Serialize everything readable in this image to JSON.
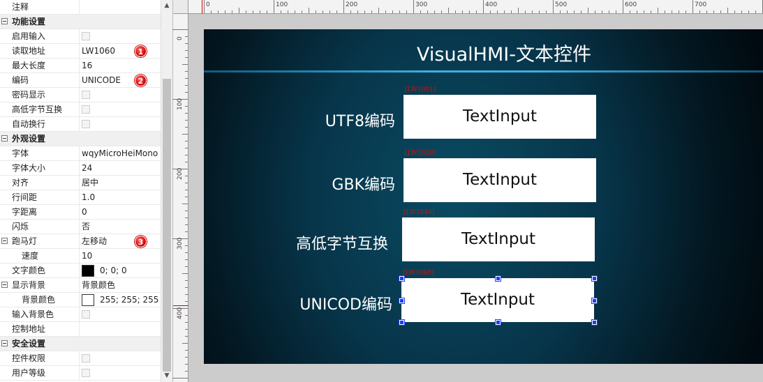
{
  "property_panel": {
    "rows": [
      {
        "kind": "prop",
        "name": "注释",
        "value": ""
      },
      {
        "kind": "section",
        "name": "功能设置"
      },
      {
        "kind": "prop",
        "name": "启用输入",
        "checkbox": true
      },
      {
        "kind": "prop",
        "name": "读取地址",
        "value": "LW1060",
        "badge": "1"
      },
      {
        "kind": "prop",
        "name": "最大长度",
        "value": "16"
      },
      {
        "kind": "prop",
        "name": "编码",
        "value": "UNICODE",
        "badge": "2"
      },
      {
        "kind": "prop",
        "name": "密码显示",
        "checkbox": true
      },
      {
        "kind": "prop",
        "name": "高低字节互换",
        "checkbox": true
      },
      {
        "kind": "prop",
        "name": "自动换行",
        "checkbox": true
      },
      {
        "kind": "section",
        "name": "外观设置"
      },
      {
        "kind": "prop",
        "name": "字体",
        "value": "wqyMicroHeiMono"
      },
      {
        "kind": "prop",
        "name": "字体大小",
        "value": "24"
      },
      {
        "kind": "prop",
        "name": "对齐",
        "value": "居中"
      },
      {
        "kind": "prop",
        "name": "行间距",
        "value": "1.0"
      },
      {
        "kind": "prop",
        "name": "字距离",
        "value": "0"
      },
      {
        "kind": "prop",
        "name": "闪烁",
        "value": "否"
      },
      {
        "kind": "prop",
        "name": "跑马灯",
        "value": "左移动",
        "badge": "3",
        "toggle": true
      },
      {
        "kind": "prop",
        "name": "速度",
        "value": "10",
        "indent": true
      },
      {
        "kind": "prop",
        "name": "文字颜色",
        "value": "0; 0; 0",
        "swatch": "#000000"
      },
      {
        "kind": "prop",
        "name": "显示背景",
        "value": "背景颜色",
        "toggle": true
      },
      {
        "kind": "prop",
        "name": "背景颜色",
        "value": "255; 255; 255",
        "swatch": "#ffffff",
        "indent": true
      },
      {
        "kind": "prop",
        "name": "输入背景色",
        "checkbox": true
      },
      {
        "kind": "prop",
        "name": "控制地址",
        "value": ""
      },
      {
        "kind": "section",
        "name": "安全设置"
      },
      {
        "kind": "prop",
        "name": "控件权限",
        "checkbox": true
      },
      {
        "kind": "prop",
        "name": "用户等级",
        "checkbox": true
      }
    ]
  },
  "scrollbar": {
    "up_icon": "▲",
    "down_icon": "▼"
  },
  "ruler": {
    "top_labels": [
      "0",
      "100",
      "200",
      "300",
      "400",
      "500",
      "600",
      "700"
    ],
    "left_labels": [
      "0",
      "100",
      "200",
      "300",
      "400"
    ]
  },
  "screen": {
    "title": "VisualHMI-文本控件",
    "rows": [
      {
        "label": "UTF8编码",
        "address": "[LW1001]",
        "text": "TextInput"
      },
      {
        "label": "GBK编码",
        "address": "[LW1020]",
        "text": "TextInput"
      },
      {
        "label": "高低字节互换",
        "address": "[LW1040]",
        "text": "TextInput"
      },
      {
        "label": "UNICOD编码",
        "address": "[LW1060]",
        "text": "TextInput",
        "selected": true
      }
    ]
  },
  "colors": {
    "badge": "#d40000",
    "accent_line": "#3db6ea",
    "address_text": "#c01818",
    "selection_handle": "#1a3cff"
  }
}
